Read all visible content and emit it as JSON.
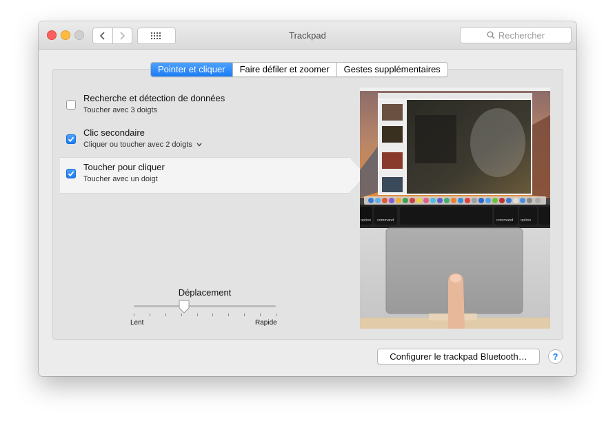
{
  "window": {
    "title": "Trackpad",
    "search_placeholder": "Rechercher"
  },
  "tabs": [
    {
      "label": "Pointer et cliquer",
      "active": true
    },
    {
      "label": "Faire défiler et zoomer",
      "active": false
    },
    {
      "label": "Gestes supplémentaires",
      "active": false
    }
  ],
  "options": [
    {
      "title": "Recherche et détection de données",
      "subtitle": "Toucher avec 3 doigts",
      "checked": false,
      "selected": false
    },
    {
      "title": "Clic secondaire",
      "subtitle": "Cliquer ou toucher avec 2 doigts",
      "checked": true,
      "selected": false,
      "has_dropdown": true
    },
    {
      "title": "Toucher pour cliquer",
      "subtitle": "Toucher avec un doigt",
      "checked": true,
      "selected": true
    }
  ],
  "tracking_speed": {
    "label": "Déplacement",
    "min_label": "Lent",
    "max_label": "Rapide",
    "value": 0.35,
    "ticks": 10
  },
  "preview": {
    "keyboard_keys": [
      "option",
      "command",
      "command",
      "option"
    ]
  },
  "footer": {
    "bluetooth_button": "Configurer le trackpad Bluetooth…",
    "help_label": "?"
  },
  "colors": {
    "accent": "#1a7cf6",
    "close": "#fc605c",
    "minimize": "#fdbc40"
  }
}
